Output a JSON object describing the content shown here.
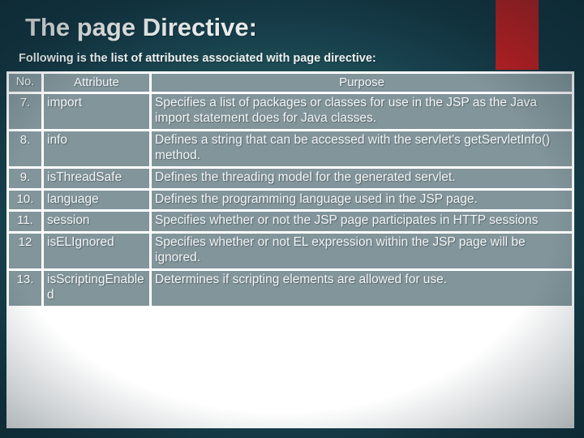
{
  "slide": {
    "title": "The page Directive:",
    "subtitle": "Following is the list of attributes associated with page directive:",
    "accent_color": "#b71f22",
    "background_dark": "#123440",
    "background_light": "#4a8a78",
    "text_color": "#f2f6f6",
    "grid_color": "#ffffff"
  },
  "table": {
    "headers": {
      "no": "No.",
      "attribute": "Attribute",
      "purpose": "Purpose"
    },
    "rows": [
      {
        "no": "7.",
        "attribute": "import",
        "purpose": "Specifies a list of packages or classes for use in the JSP as the Java import statement does for Java classes."
      },
      {
        "no": "8.",
        "attribute": "info",
        "purpose": "Defines a string that can be accessed with the servlet's getServletInfo() method."
      },
      {
        "no": "9.",
        "attribute": "isThreadSafe",
        "purpose": "Defines the threading model for the generated servlet."
      },
      {
        "no": "10.",
        "attribute": "language",
        "purpose": "Defines the programming language used in the JSP page."
      },
      {
        "no": "11.",
        "attribute": "session",
        "purpose": "Specifies whether or not the JSP page participates in HTTP sessions"
      },
      {
        "no": "12",
        "attribute": "isELIgnored",
        "purpose": "Specifies whether or not EL expression within the JSP page will be ignored."
      },
      {
        "no": "13.",
        "attribute": "isScriptingEnabled",
        "purpose": "Determines if scripting elements are allowed for use."
      }
    ]
  }
}
